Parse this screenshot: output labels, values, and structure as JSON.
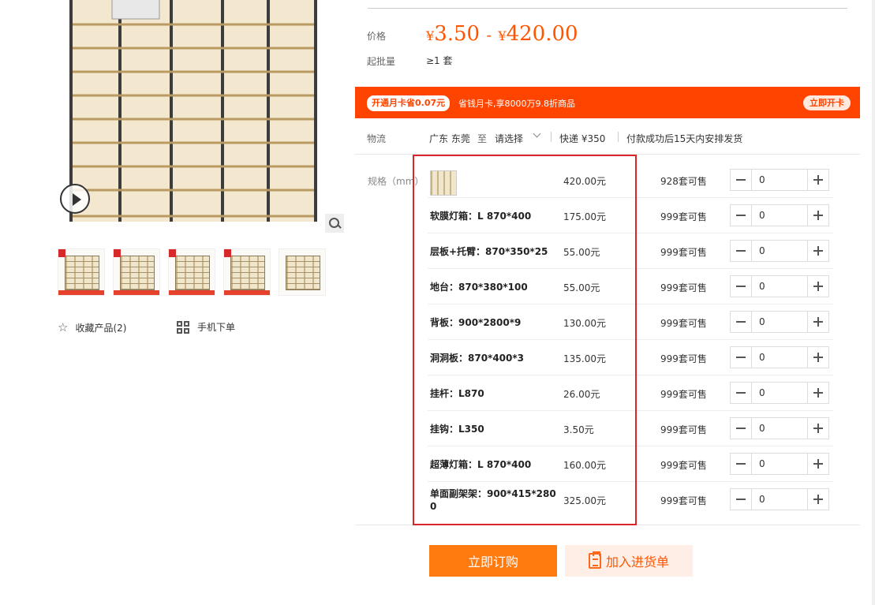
{
  "gallery": {
    "favorite_label": "收藏产品(2)",
    "mobile_order_label": "手机下单",
    "thumbnails": [
      "thumb-1",
      "thumb-2",
      "thumb-3",
      "thumb-4",
      "thumb-5"
    ]
  },
  "price": {
    "label": "价格",
    "currency": "¥",
    "low": "3.50",
    "separator": "-",
    "high": "420.00"
  },
  "moq": {
    "label": "起批量",
    "value": "≥1 套"
  },
  "promo": {
    "pill": "开通月卡省0.07元",
    "description": "省钱月卡,享8000万9.8折商品",
    "button": "立即开卡"
  },
  "shipping": {
    "label": "物流",
    "origin": "广东 东莞",
    "to": "至",
    "destination": "请选择",
    "express": "快递 ¥350",
    "note": "付款成功后15天内安排发货"
  },
  "spec": {
    "label": "规格（mm）",
    "rows": [
      {
        "name": "",
        "price": "420.00元",
        "stock": "928套可售",
        "qty": "0"
      },
      {
        "name": "软膜灯箱：L 870*400",
        "price": "175.00元",
        "stock": "999套可售",
        "qty": "0"
      },
      {
        "name": "层板+托臂：870*350*25",
        "price": "55.00元",
        "stock": "999套可售",
        "qty": "0"
      },
      {
        "name": "地台：870*380*100",
        "price": "55.00元",
        "stock": "999套可售",
        "qty": "0"
      },
      {
        "name": "背板：900*2800*9",
        "price": "130.00元",
        "stock": "999套可售",
        "qty": "0"
      },
      {
        "name": "洞洞板：870*400*3",
        "price": "135.00元",
        "stock": "999套可售",
        "qty": "0"
      },
      {
        "name": "挂杆：L870",
        "price": "26.00元",
        "stock": "999套可售",
        "qty": "0"
      },
      {
        "name": "挂钩：L350",
        "price": "3.50元",
        "stock": "999套可售",
        "qty": "0"
      },
      {
        "name": "超薄灯箱：L 870*400",
        "price": "160.00元",
        "stock": "999套可售",
        "qty": "0"
      },
      {
        "name": "单面副架架：900*415*2800",
        "price": "325.00元",
        "stock": "999套可售",
        "qty": "0"
      }
    ]
  },
  "actions": {
    "order": "立即订购",
    "add_to_list": "加入进货单"
  },
  "colors": {
    "accent": "#ff5500",
    "banner": "#ff4400",
    "highlight_border": "#d9262c"
  }
}
